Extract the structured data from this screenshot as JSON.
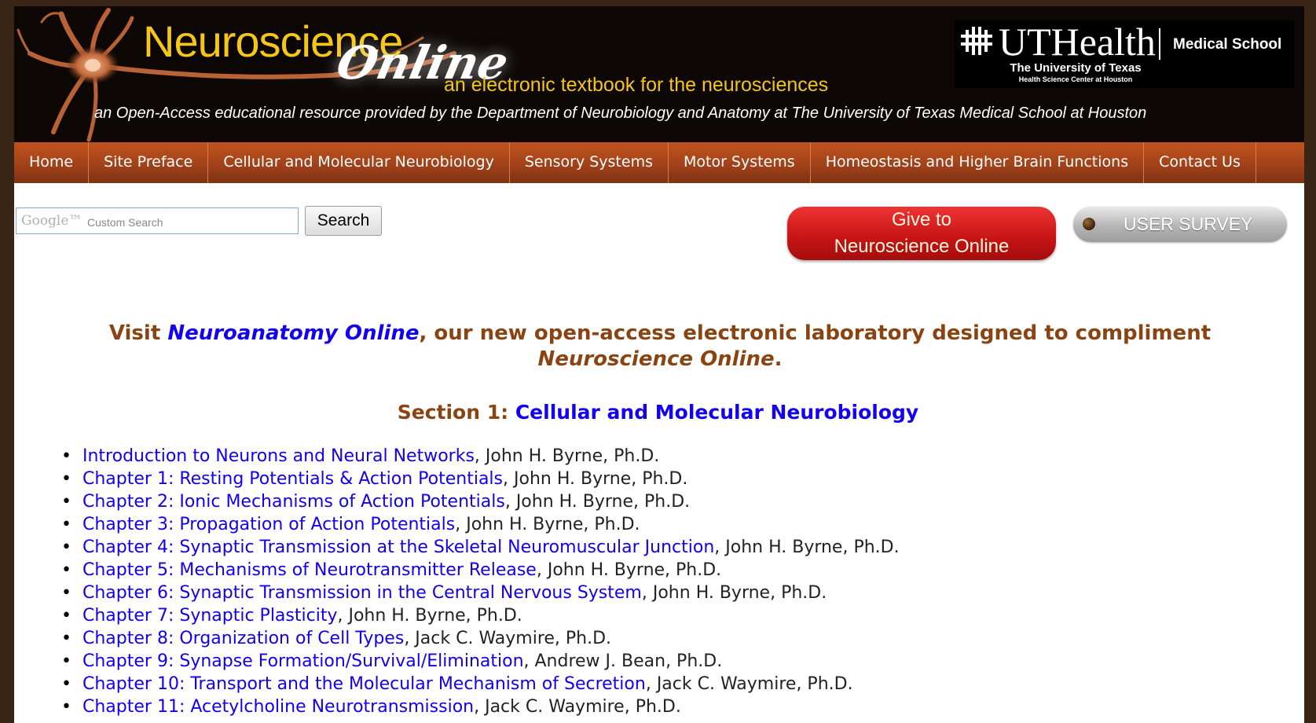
{
  "header": {
    "title_main": "Neuroscience",
    "title_script": "Online",
    "tagline": "an electronic textbook for the neurosciences",
    "subtagline": "an Open-Access educational resource provided by the Department of Neurobiology and Anatomy at The University of Texas Medical School at Houston",
    "logo": {
      "name": "UTHealth",
      "school": "Medical School",
      "university": "The University of Texas",
      "center": "Health Science Center at Houston"
    }
  },
  "nav": {
    "items": [
      {
        "label": "Home"
      },
      {
        "label": "Site Preface"
      },
      {
        "label": "Cellular and Molecular Neurobiology"
      },
      {
        "label": "Sensory Systems"
      },
      {
        "label": "Motor Systems"
      },
      {
        "label": "Homeostasis and Higher Brain Functions"
      },
      {
        "label": "Contact Us"
      }
    ]
  },
  "search": {
    "placeholder_brand": "Google™",
    "placeholder": "Custom Search",
    "button_label": "Search"
  },
  "give": {
    "line1": "Give to",
    "line2": "Neuroscience Online"
  },
  "survey": {
    "label": "USER SURVEY"
  },
  "promo": {
    "prefix": "Visit ",
    "link": "Neuroanatomy Online",
    "middle": ", our new open-access electronic laboratory designed to compliment ",
    "italic": "Neuroscience Online",
    "suffix": "."
  },
  "section": {
    "prefix": "Section 1: ",
    "title": "Cellular and Molecular Neurobiology"
  },
  "chapters": [
    {
      "title": "Introduction to Neurons and Neural Networks",
      "author": ", John H. Byrne, Ph.D."
    },
    {
      "title": "Chapter 1: Resting Potentials & Action Potentials",
      "author": ", John H. Byrne, Ph.D."
    },
    {
      "title": "Chapter 2: Ionic Mechanisms of Action Potentials",
      "author": ", John H. Byrne, Ph.D."
    },
    {
      "title": "Chapter 3: Propagation of Action Potentials",
      "author": ", John H. Byrne, Ph.D."
    },
    {
      "title": "Chapter 4: Synaptic Transmission at the Skeletal Neuromuscular Junction",
      "author": ", John H. Byrne, Ph.D."
    },
    {
      "title": "Chapter 5: Mechanisms of Neurotransmitter Release",
      "author": ", John H. Byrne, Ph.D."
    },
    {
      "title": "Chapter 6: Synaptic Transmission in the Central Nervous System",
      "author": ", John H. Byrne, Ph.D."
    },
    {
      "title": "Chapter 7: Synaptic Plasticity",
      "author": ", John H. Byrne, Ph.D."
    },
    {
      "title": "Chapter 8: Organization of Cell Types",
      "author": ", Jack C. Waymire, Ph.D."
    },
    {
      "title": "Chapter 9: Synapse Formation/Survival/Elimination",
      "author": ", Andrew J. Bean, Ph.D."
    },
    {
      "title": "Chapter 10: Transport and the Molecular Mechanism of Secretion",
      "author": ", Jack C. Waymire, Ph.D."
    },
    {
      "title": "Chapter 11: Acetylcholine Neurotransmission",
      "author": ", Jack C. Waymire, Ph.D."
    }
  ],
  "colors": {
    "header_bg": "#0d0806",
    "brand_gold": "#f5c518",
    "nav_bg": "#a2421a",
    "heading_brown": "#8a4412",
    "link_blue": "#1200ee",
    "give_red": "#c61414"
  }
}
